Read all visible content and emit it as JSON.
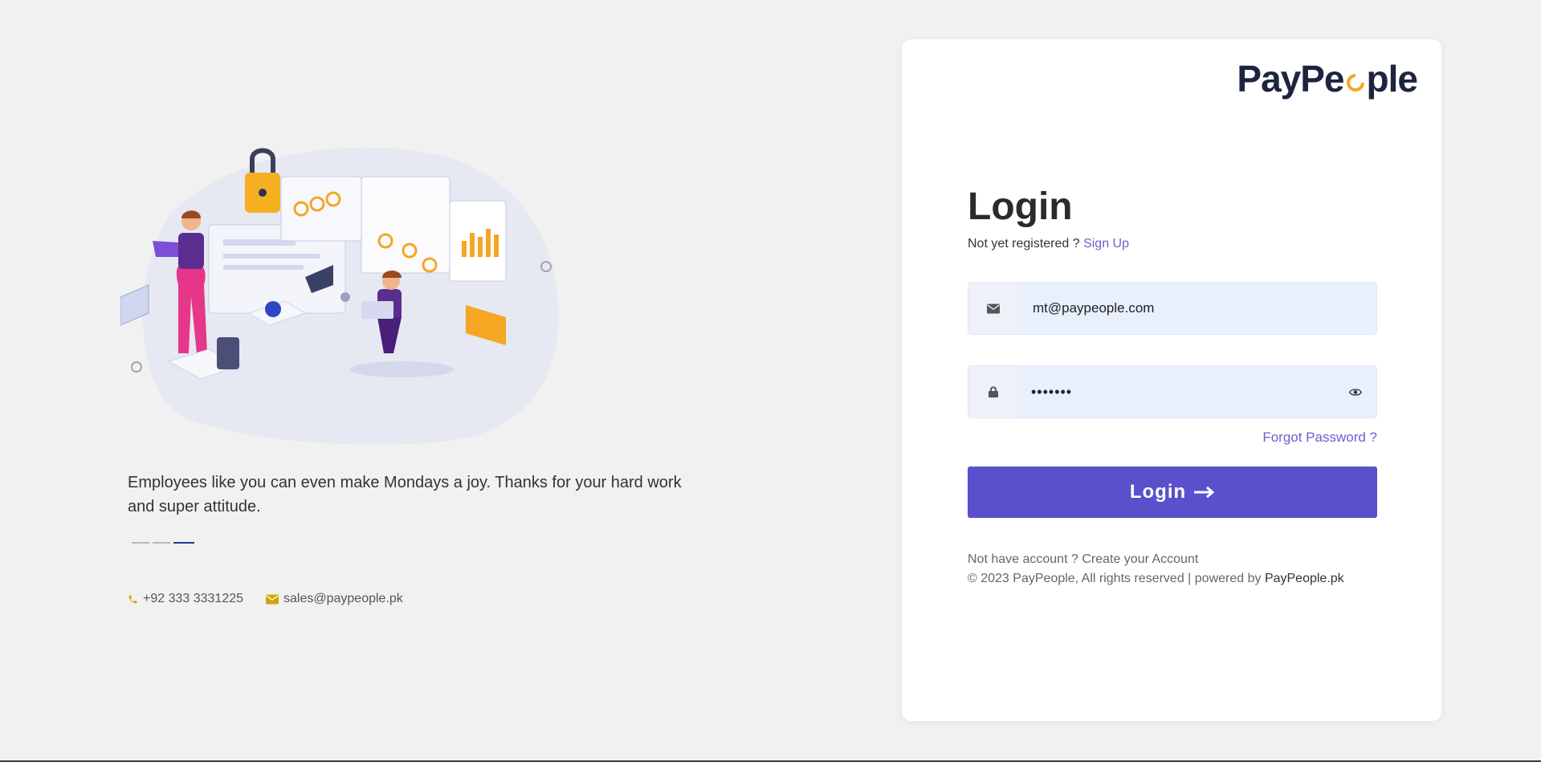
{
  "left": {
    "testimonial": "Employees like you can even make Mondays a joy. Thanks for your hard work and super attitude.",
    "contacts": {
      "phone": "+92 333 3331225",
      "email": "sales@paypeople.pk"
    }
  },
  "card": {
    "logo_pre": "PayPe",
    "logo_post": "ple",
    "title": "Login",
    "register_text": "Not yet registered ?",
    "signup_label": "Sign Up",
    "email_value": "mt@paypeople.com",
    "password_value": "•••••••",
    "forgot_label": "Forgot Password ?",
    "login_label": "Login",
    "no_account_text": "Not have account ?",
    "create_account_label": "Create your Account",
    "copyright": "© 2023 PayPeople, All rights reserved | powered by",
    "powered_link": "PayPeople.pk"
  },
  "colors": {
    "primary": "#5a50cc",
    "link": "#6a5fd0",
    "accent": "#f5a623",
    "input_bg": "#e8effd"
  }
}
